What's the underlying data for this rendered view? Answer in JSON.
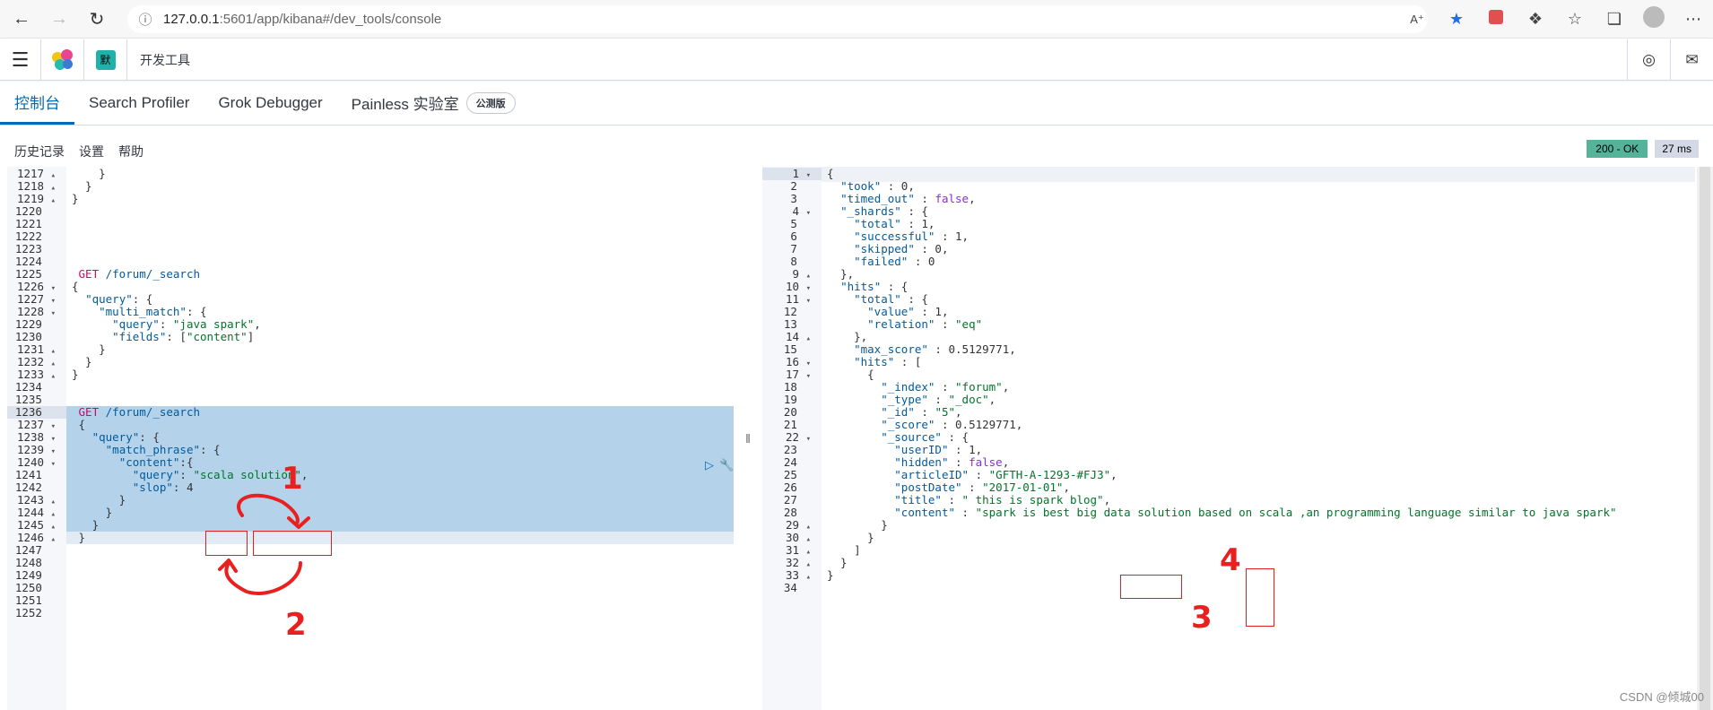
{
  "browser": {
    "url_host": "127.0.0.1",
    "url_rest": ":5601/app/kibana#/dev_tools/console"
  },
  "header": {
    "space_badge": "默",
    "breadcrumb": "开发工具"
  },
  "tabs": [
    {
      "label": "控制台"
    },
    {
      "label": "Search Profiler"
    },
    {
      "label": "Grok Debugger"
    },
    {
      "label": "Painless 实验室"
    }
  ],
  "beta_badge": "公测版",
  "toolbar": {
    "history": "历史记录",
    "settings": "设置",
    "help": "帮助",
    "status_ok": "200 - OK",
    "status_ms": "27 ms"
  },
  "left_editor": {
    "lines": [
      {
        "n": "1217",
        "fold": "▴",
        "text": "    }"
      },
      {
        "n": "1218",
        "fold": "▴",
        "text": "  }"
      },
      {
        "n": "1219",
        "fold": "▴",
        "text": "}"
      },
      {
        "n": "1220",
        "fold": "",
        "text": ""
      },
      {
        "n": "1221",
        "fold": "",
        "text": ""
      },
      {
        "n": "1222",
        "fold": "",
        "text": ""
      },
      {
        "n": "1223",
        "fold": "",
        "text": ""
      },
      {
        "n": "1224",
        "fold": "",
        "text": ""
      },
      {
        "n": "1225",
        "fold": "",
        "text": " GET /forum/_search"
      },
      {
        "n": "1226",
        "fold": "▾",
        "text": "{"
      },
      {
        "n": "1227",
        "fold": "▾",
        "text": "  \"query\": {"
      },
      {
        "n": "1228",
        "fold": "▾",
        "text": "    \"multi_match\": {"
      },
      {
        "n": "1229",
        "fold": "",
        "text": "      \"query\": \"java spark\","
      },
      {
        "n": "1230",
        "fold": "",
        "text": "      \"fields\": [\"content\"]"
      },
      {
        "n": "1231",
        "fold": "▴",
        "text": "    }"
      },
      {
        "n": "1232",
        "fold": "▴",
        "text": "  }"
      },
      {
        "n": "1233",
        "fold": "▴",
        "text": "}"
      },
      {
        "n": "1234",
        "fold": "",
        "text": ""
      },
      {
        "n": "1235",
        "fold": "",
        "text": ""
      },
      {
        "n": "1236",
        "fold": "",
        "text": " GET /forum/_search"
      },
      {
        "n": "1237",
        "fold": "▾",
        "text": " {"
      },
      {
        "n": "1238",
        "fold": "▾",
        "text": "   \"query\": {"
      },
      {
        "n": "1239",
        "fold": "▾",
        "text": "     \"match_phrase\": {"
      },
      {
        "n": "1240",
        "fold": "▾",
        "text": "       \"content\":{"
      },
      {
        "n": "1241",
        "fold": "",
        "text": "         \"query\": \"scala solution\","
      },
      {
        "n": "1242",
        "fold": "",
        "text": "         \"slop\": 4"
      },
      {
        "n": "1243",
        "fold": "▴",
        "text": "       }"
      },
      {
        "n": "1244",
        "fold": "▴",
        "text": "     }"
      },
      {
        "n": "1245",
        "fold": "▴",
        "text": "   }"
      },
      {
        "n": "1246",
        "fold": "▴",
        "text": " }"
      },
      {
        "n": "1247",
        "fold": "",
        "text": ""
      },
      {
        "n": "1248",
        "fold": "",
        "text": ""
      },
      {
        "n": "1249",
        "fold": "",
        "text": ""
      },
      {
        "n": "1250",
        "fold": "",
        "text": ""
      },
      {
        "n": "1251",
        "fold": "",
        "text": ""
      },
      {
        "n": "1252",
        "fold": "",
        "text": ""
      }
    ]
  },
  "right_editor": {
    "lines": [
      {
        "n": "1",
        "fold": "▾",
        "text": "{"
      },
      {
        "n": "2",
        "fold": "",
        "text": "  \"took\" : 0,"
      },
      {
        "n": "3",
        "fold": "",
        "text": "  \"timed_out\" : false,"
      },
      {
        "n": "4",
        "fold": "▾",
        "text": "  \"_shards\" : {"
      },
      {
        "n": "5",
        "fold": "",
        "text": "    \"total\" : 1,"
      },
      {
        "n": "6",
        "fold": "",
        "text": "    \"successful\" : 1,"
      },
      {
        "n": "7",
        "fold": "",
        "text": "    \"skipped\" : 0,"
      },
      {
        "n": "8",
        "fold": "",
        "text": "    \"failed\" : 0"
      },
      {
        "n": "9",
        "fold": "▴",
        "text": "  },"
      },
      {
        "n": "10",
        "fold": "▾",
        "text": "  \"hits\" : {"
      },
      {
        "n": "11",
        "fold": "▾",
        "text": "    \"total\" : {"
      },
      {
        "n": "12",
        "fold": "",
        "text": "      \"value\" : 1,"
      },
      {
        "n": "13",
        "fold": "",
        "text": "      \"relation\" : \"eq\""
      },
      {
        "n": "14",
        "fold": "▴",
        "text": "    },"
      },
      {
        "n": "15",
        "fold": "",
        "text": "    \"max_score\" : 0.5129771,"
      },
      {
        "n": "16",
        "fold": "▾",
        "text": "    \"hits\" : ["
      },
      {
        "n": "17",
        "fold": "▾",
        "text": "      {"
      },
      {
        "n": "18",
        "fold": "",
        "text": "        \"_index\" : \"forum\","
      },
      {
        "n": "19",
        "fold": "",
        "text": "        \"_type\" : \"_doc\","
      },
      {
        "n": "20",
        "fold": "",
        "text": "        \"_id\" : \"5\","
      },
      {
        "n": "21",
        "fold": "",
        "text": "        \"_score\" : 0.5129771,"
      },
      {
        "n": "22",
        "fold": "▾",
        "text": "        \"_source\" : {"
      },
      {
        "n": "23",
        "fold": "",
        "text": "          \"userID\" : 1,"
      },
      {
        "n": "24",
        "fold": "",
        "text": "          \"hidden\" : false,"
      },
      {
        "n": "25",
        "fold": "",
        "text": "          \"articleID\" : \"GFTH-A-1293-#FJ3\","
      },
      {
        "n": "26",
        "fold": "",
        "text": "          \"postDate\" : \"2017-01-01\","
      },
      {
        "n": "27",
        "fold": "",
        "text": "          \"title\" : \" this is spark blog\","
      },
      {
        "n": "28",
        "fold": "",
        "text": "          \"content\" : \"spark is best big data solution based on scala ,an programming language similar to java spark\""
      },
      {
        "n": "29",
        "fold": "▴",
        "text": "        }"
      },
      {
        "n": "30",
        "fold": "▴",
        "text": "      }"
      },
      {
        "n": "31",
        "fold": "▴",
        "text": "    ]"
      },
      {
        "n": "32",
        "fold": "▴",
        "text": "  }"
      },
      {
        "n": "33",
        "fold": "▴",
        "text": "}"
      },
      {
        "n": "34",
        "fold": "",
        "text": ""
      }
    ]
  },
  "annotations": {
    "a1": "1",
    "a2": "2",
    "a3": "3",
    "a4": "4"
  },
  "watermark": "CSDN @倾城00",
  "colors": {
    "accent": "#006bb4",
    "selection": "#b4d3ea",
    "status_ok": "#54b399",
    "annotation_red": "#e02020"
  }
}
